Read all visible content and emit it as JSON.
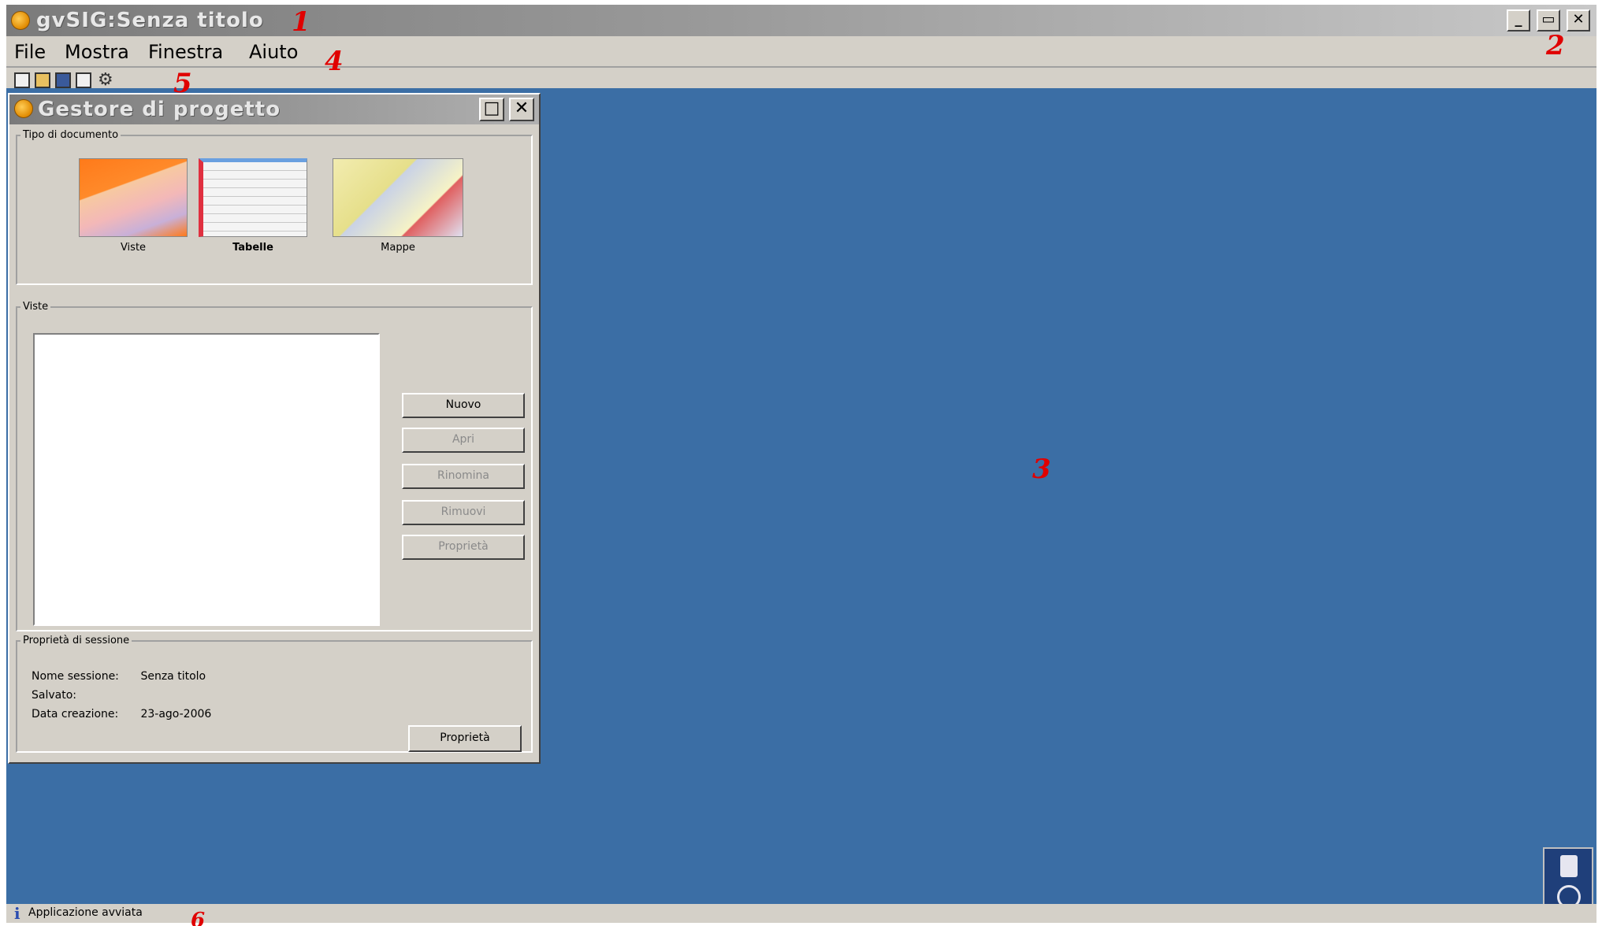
{
  "window": {
    "title": "gvSIG:Senza titolo",
    "controls": {
      "minimize": "_",
      "maximize": "▭",
      "close": "✕"
    }
  },
  "menubar": {
    "items": [
      "File",
      "Mostra",
      "Finestra",
      "Aiuto"
    ]
  },
  "toolbar": {
    "icons": [
      "new-project-icon",
      "open-project-icon",
      "save-project-icon",
      "project-properties-icon",
      "settings-icon"
    ]
  },
  "project_manager": {
    "title": "Gestore di progetto",
    "document_types": {
      "legend": "Tipo di documento",
      "items": [
        {
          "label": "Viste",
          "icon": "view-icon"
        },
        {
          "label": "Tabelle",
          "icon": "table-icon"
        },
        {
          "label": "Mappe",
          "icon": "map-icon"
        }
      ]
    },
    "documents": {
      "legend": "Viste",
      "buttons": {
        "new": "Nuovo",
        "open": "Apri",
        "rename": "Rinomina",
        "remove": "Rimuovi",
        "properties": "Proprietà"
      }
    },
    "session": {
      "legend": "Proprietà di sessione",
      "rows": [
        {
          "key": "Nome sessione:",
          "value": "Senza titolo"
        },
        {
          "key": "Salvato:",
          "value": ""
        },
        {
          "key": "Data creazione:",
          "value": "23-ago-2006"
        }
      ],
      "properties_button": "Proprietà"
    }
  },
  "statusbar": {
    "text": "Applicazione avviata"
  },
  "annotations": {
    "n1": "1",
    "n2": "2",
    "n3": "3",
    "n4": "4",
    "n5": "5",
    "n6": "6"
  },
  "colors": {
    "desktop": "#3b6ea5",
    "chrome": "#d4d0c8",
    "annotation": "#e00000"
  }
}
